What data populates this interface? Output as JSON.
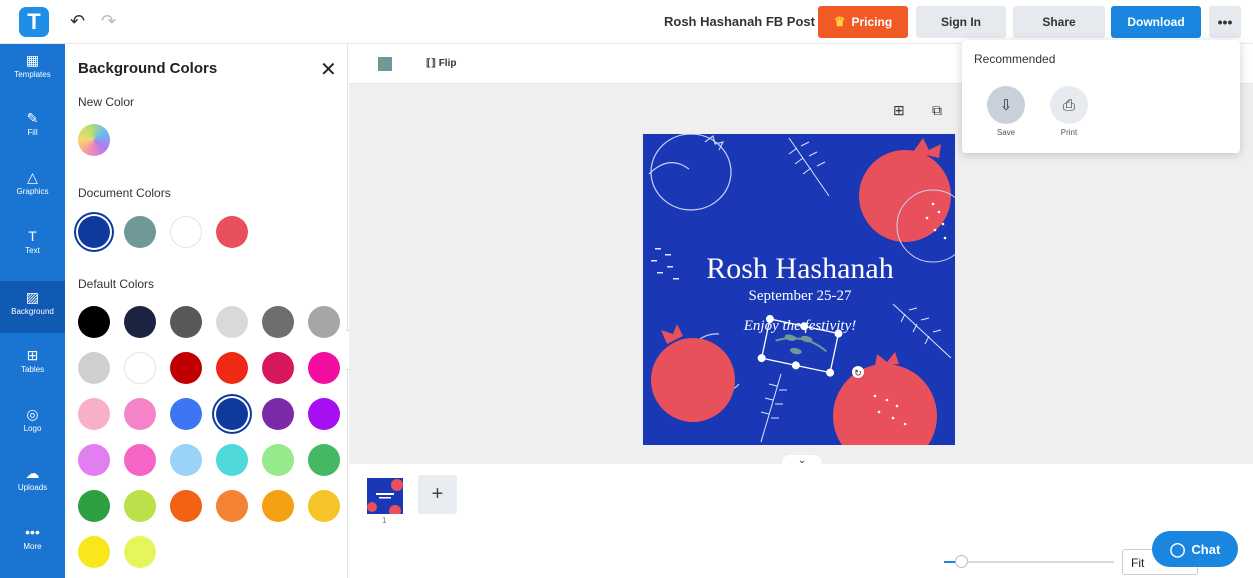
{
  "topbar": {
    "logo_letter": "T",
    "undo_icon": "↶",
    "redo_icon": "↷",
    "document_title": "Rosh Hashanah FB Post",
    "pricing_label": "Pricing",
    "pricing_icon": "♛",
    "signin_label": "Sign In",
    "share_label": "Share",
    "download_label": "Download",
    "more_label": "•••"
  },
  "rail": [
    {
      "label": "Templates",
      "icon": "▦"
    },
    {
      "label": "Fill",
      "icon": "✎"
    },
    {
      "label": "Graphics",
      "icon": "△"
    },
    {
      "label": "Text",
      "icon": "T"
    },
    {
      "label": "Background",
      "icon": "▨"
    },
    {
      "label": "Tables",
      "icon": "⊞"
    },
    {
      "label": "Logo",
      "icon": "◎"
    },
    {
      "label": "Uploads",
      "icon": "☁"
    },
    {
      "label": "More",
      "icon": "•••"
    }
  ],
  "panel": {
    "title": "Background Colors",
    "close_icon": "✕",
    "new_color_label": "New Color",
    "document_colors_label": "Document Colors",
    "default_colors_label": "Default Colors",
    "document_colors": [
      "#0d3a9c",
      "#6f9897",
      "#ffffff",
      "#e8505b"
    ],
    "default_colors": [
      "#000000",
      "#1c2340",
      "#585858",
      "#d9d9d9",
      "#6e6e6e",
      "#a6a6a6",
      "#cfcfcf",
      "#ffffff",
      "#c00000",
      "#f02a12",
      "#d6175e",
      "#f20fa0",
      "#f6b0c7",
      "#f483c8",
      "#3d76f2",
      "#0d3a9c",
      "#7a2aa7",
      "#a50ff2",
      "#e17ef0",
      "#f565c5",
      "#9ad3f7",
      "#4fd9d9",
      "#95ea8c",
      "#45b864",
      "#2e9f40",
      "#bce04a",
      "#f26214",
      "#f58233",
      "#f5a013",
      "#f7c52a",
      "#f8e81b",
      "#e6f55c"
    ]
  },
  "collapse_icon": "‹",
  "toolbar": {
    "flip_label": "Flip",
    "flip_icon": "⟦⟧"
  },
  "canvas": {
    "add_icon": "⊞",
    "copy_icon": "⧉",
    "design": {
      "title": "Rosh Hashanah",
      "date": "September 25-27",
      "tagline": "Enjoy the festivity!",
      "background": "#1a37b5",
      "fruit_color": "#e8505b"
    }
  },
  "bottom": {
    "collapse_icon": "⌄",
    "page_number": "1",
    "add_page_icon": "+",
    "zoom_value": "Fit",
    "chat_label": "Chat",
    "chat_icon": "◯"
  },
  "dropdown": {
    "title": "Recommended",
    "save_label": "Save",
    "save_icon": "⇩",
    "print_label": "Print",
    "print_icon": "⎙"
  }
}
